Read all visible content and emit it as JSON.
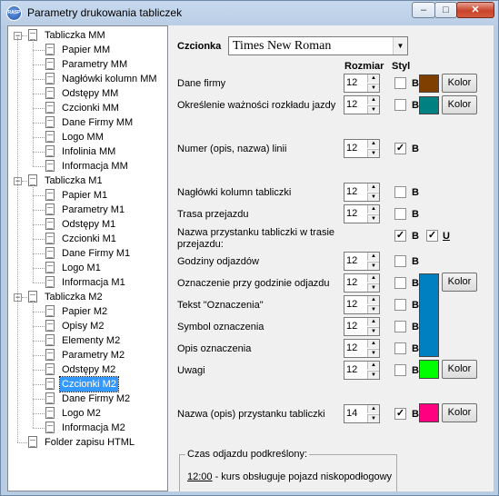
{
  "window": {
    "title": "Parametry drukowania tabliczek",
    "app_icon_text": "RASP",
    "controls": {
      "minimize": "–",
      "maximize": "□",
      "close": "✕"
    }
  },
  "tree": {
    "groups": [
      {
        "label": "Tabliczka MM",
        "expanded": true,
        "children": [
          "Papier MM",
          "Parametry MM",
          "Nagłówki kolumn MM",
          "Odstępy MM",
          "Czcionki MM",
          "Dane Firmy MM",
          "Logo MM",
          "Infolinia MM",
          "Informacja MM"
        ]
      },
      {
        "label": "Tabliczka M1",
        "expanded": true,
        "children": [
          "Papier M1",
          "Parametry M1",
          "Odstępy M1",
          "Czcionki M1",
          "Dane Firmy M1",
          "Logo M1",
          "Informacja M1"
        ]
      },
      {
        "label": "Tabliczka M2",
        "expanded": true,
        "children": [
          "Papier M2",
          "Opisy M2",
          "Elementy M2",
          "Parametry M2",
          "Odstępy M2",
          "Czcionki M2",
          "Dane Firmy M2",
          "Logo M2",
          "Informacja M2"
        ]
      }
    ],
    "footer_item": "Folder zapisu HTML",
    "selected": "Czcionki M2"
  },
  "font": {
    "label": "Czcionka",
    "value": "Times New Roman"
  },
  "headers": {
    "size": "Rozmiar",
    "style": "Styl"
  },
  "bold_label": "B",
  "underline_label": "U",
  "color_button": "Kolor",
  "rows": {
    "dane_firmy": {
      "label": "Dane firmy",
      "size": "12",
      "bold": false,
      "color": "#7f3f00"
    },
    "okreslenie": {
      "label": "Określenie ważności rozkładu jazdy",
      "size": "12",
      "bold": false,
      "color": "#008080"
    },
    "numer": {
      "label": "Numer (opis, nazwa) linii",
      "size": "12",
      "bold": true
    },
    "naglowki": {
      "label": "Nagłówki kolumn tabliczki",
      "size": "12",
      "bold": false
    },
    "trasa": {
      "label": "Trasa przejazdu",
      "size": "12",
      "bold": false
    },
    "nazwa_trasa": {
      "label": "Nazwa przystanku tabliczki w trasie przejazdu:",
      "bold": true,
      "underline": true
    },
    "godziny": {
      "label": "Godziny odjazdów",
      "size": "12",
      "bold": false
    },
    "oznaczenie": {
      "label": "Oznaczenie przy godzinie odjazdu",
      "size": "12",
      "bold": false
    },
    "tekst": {
      "label": "Tekst \"Oznaczenia\"",
      "size": "12",
      "bold": false
    },
    "symbol": {
      "label": "Symbol oznaczenia",
      "size": "12",
      "bold": false
    },
    "opis": {
      "label": "Opis oznaczenia",
      "size": "12",
      "bold": false
    },
    "uwagi": {
      "label": "Uwagi",
      "size": "12",
      "bold": false,
      "color": "#00ff00"
    },
    "nazwa_opis": {
      "label": "Nazwa (opis) przystanku tabliczki",
      "size": "14",
      "bold": true,
      "color": "#ff0080"
    }
  },
  "oznaczenie_color": "#0080c0",
  "group": {
    "caption": "Czas odjazdu podkreślony:",
    "time": "12:00",
    "text": " - kurs obsługuje pojazd niskopodłogowy"
  }
}
